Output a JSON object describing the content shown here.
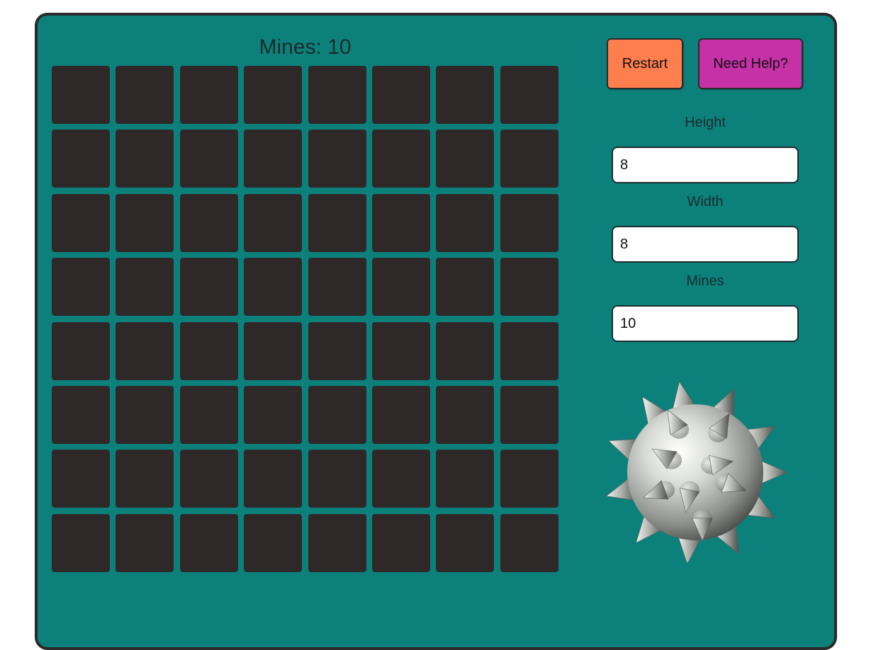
{
  "header": {
    "mines_label": "Mines: 10"
  },
  "controls": {
    "restart_label": "Restart",
    "help_label": "Need Help?"
  },
  "settings": {
    "height_label": "Height",
    "height_value": "8",
    "width_label": "Width",
    "width_value": "8",
    "mines_label": "Mines",
    "mines_value": "10"
  },
  "board": {
    "rows": 8,
    "cols": 8,
    "cell_state": "hidden"
  },
  "illustration": {
    "icon": "mine-icon"
  },
  "colors": {
    "panel": "#0c817b",
    "cell": "#2e2829",
    "restart": "#ff7e4d",
    "help": "#c631a8"
  }
}
